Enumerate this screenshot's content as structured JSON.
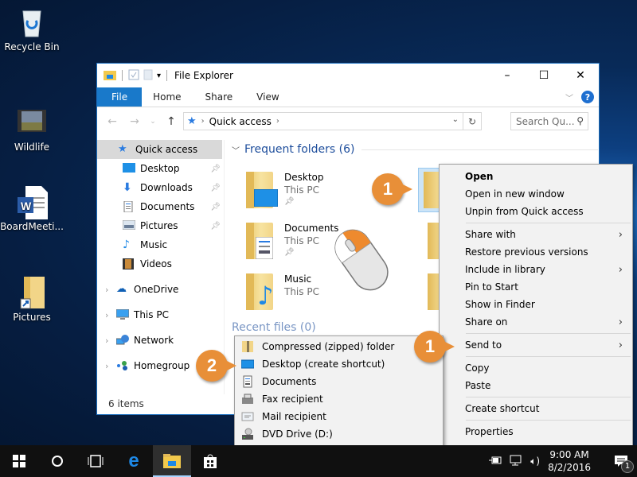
{
  "desktop": {
    "icons": [
      {
        "label": "Recycle Bin",
        "icon": "recycle-bin-icon"
      },
      {
        "label": "Wildlife",
        "icon": "video-file-icon"
      },
      {
        "label": "BoardMeeti...",
        "icon": "word-document-icon"
      },
      {
        "label": "Pictures",
        "icon": "folder-shortcut-icon"
      }
    ]
  },
  "window": {
    "title": "File Explorer",
    "controls": {
      "minimize": "–",
      "maximize": "☐",
      "close": "✕"
    },
    "ribbon_tabs": [
      "File",
      "Home",
      "Share",
      "View"
    ],
    "help": "?",
    "address": {
      "crumbs": [
        "Quick access"
      ]
    },
    "search_placeholder": "Search Qu...",
    "nav": {
      "quick_access": "Quick access",
      "pinned": [
        {
          "label": "Desktop",
          "pinned": true
        },
        {
          "label": "Downloads",
          "pinned": true
        },
        {
          "label": "Documents",
          "pinned": true
        },
        {
          "label": "Pictures",
          "pinned": true
        },
        {
          "label": "Music",
          "pinned": false
        },
        {
          "label": "Videos",
          "pinned": false
        }
      ],
      "groups": [
        "OneDrive",
        "This PC",
        "Network",
        "Homegroup"
      ]
    },
    "content": {
      "section_title": "Frequent folders (6)",
      "folders": [
        {
          "name": "Desktop",
          "location": "This PC",
          "pinned": true
        },
        {
          "name": "Documents",
          "location": "This PC",
          "pinned": true
        },
        {
          "name": "Music",
          "location": "This PC",
          "pinned": false
        }
      ],
      "recent_section_partial": "Recent files (0)"
    },
    "status": "6 items"
  },
  "context_menu": {
    "items": [
      {
        "label": "Open",
        "bold": true
      },
      {
        "label": "Open in new window"
      },
      {
        "label": "Unpin from Quick access"
      },
      {
        "sep": true
      },
      {
        "label": "Share with",
        "submenu": true
      },
      {
        "label": "Restore previous versions"
      },
      {
        "label": "Include in library",
        "submenu": true
      },
      {
        "label": "Pin to Start"
      },
      {
        "label": "Show in Finder"
      },
      {
        "label": "Share on",
        "submenu": true
      },
      {
        "sep": true
      },
      {
        "label": "Send to",
        "submenu": true
      },
      {
        "sep": true
      },
      {
        "label": "Copy"
      },
      {
        "label": "Paste"
      },
      {
        "sep": true
      },
      {
        "label": "Create shortcut"
      },
      {
        "sep": true
      },
      {
        "label": "Properties"
      }
    ]
  },
  "send_to_menu": {
    "items": [
      {
        "label": "Compressed (zipped) folder",
        "icon": "zip-folder-icon"
      },
      {
        "label": "Desktop (create shortcut)",
        "icon": "desktop-icon"
      },
      {
        "label": "Documents",
        "icon": "documents-icon"
      },
      {
        "label": "Fax recipient",
        "icon": "fax-icon"
      },
      {
        "label": "Mail recipient",
        "icon": "mail-icon"
      },
      {
        "label": "DVD Drive (D:)",
        "icon": "dvd-drive-icon"
      }
    ]
  },
  "callouts": {
    "step1_folder": "1",
    "step1_sendto": "1",
    "step2": "2"
  },
  "colors": {
    "accent": "#1979ca",
    "callout": "#e88f38",
    "taskbar": "#101010"
  },
  "taskbar": {
    "clock_time": "9:00 AM",
    "clock_date": "8/2/2016",
    "notification_count": "1"
  }
}
